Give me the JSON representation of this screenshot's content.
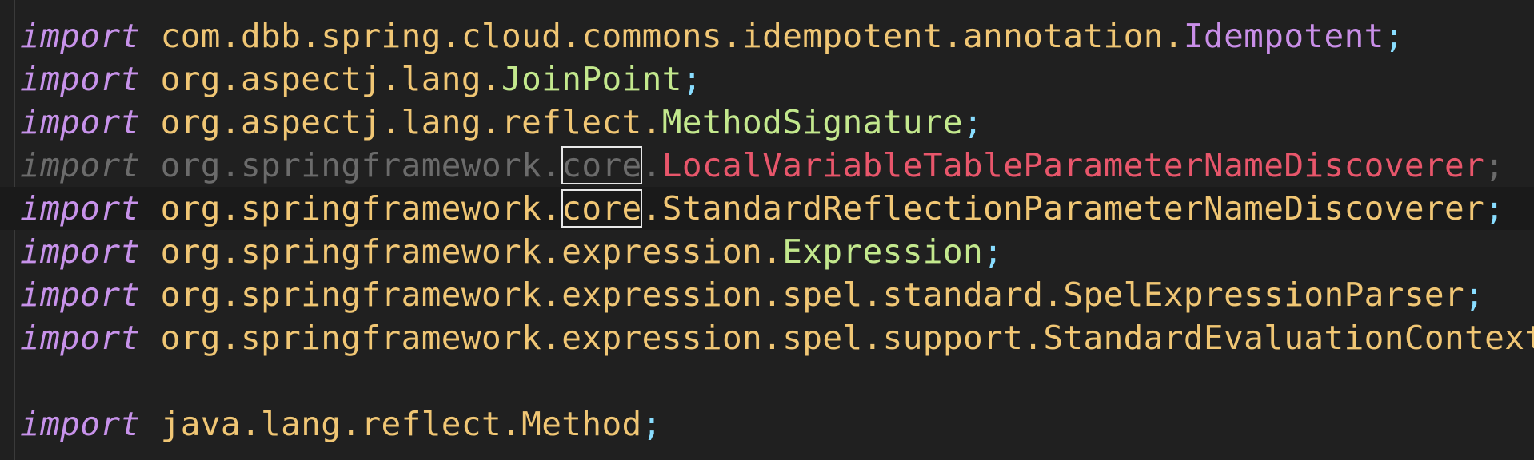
{
  "lines": [
    {
      "kw": "import",
      "pkg": "com.dbb.spring.cloud.commons.idempotent.annotation.",
      "cls": "Idempotent",
      "semi": ";"
    },
    {
      "kw": "import",
      "pkg": "org.aspectj.lang.",
      "cls": "JoinPoint",
      "semi": ";"
    },
    {
      "kw": "import",
      "pkg": "org.aspectj.lang.reflect.",
      "cls": "MethodSignature",
      "semi": ";"
    },
    {
      "kw": "import",
      "pkg_a": "org.springframework.",
      "pkg_b": "core",
      "pkg_c": ".",
      "cls": "LocalVariableTableParameterNameDiscoverer",
      "semi": ";"
    },
    {
      "kw": "import",
      "pkg_a": "org.springframework.",
      "pkg_b": "core",
      "pkg_c": ".",
      "cls": "StandardReflectionParameterNameDiscoverer",
      "semi": ";"
    },
    {
      "kw": "import",
      "pkg": "org.springframework.expression.",
      "cls": "Expression",
      "semi": ";"
    },
    {
      "kw": "import",
      "pkg": "org.springframework.expression.spel.standard.",
      "cls": "SpelExpressionParser",
      "semi": ";"
    },
    {
      "kw": "import",
      "pkg": "org.springframework.expression.spel.support.",
      "cls": "StandardEvaluationContext",
      "semi": ";"
    },
    {
      "kw": "import",
      "pkg": "java.lang.reflect.",
      "cls": "Method",
      "semi": ";"
    }
  ],
  "colors": {
    "background": "#202020",
    "keyword": "#c792ea",
    "package": "#f0c674",
    "unused_import": "#6b6b6b",
    "deprecated_class": "#e8566b",
    "punctuation": "#89ddff"
  }
}
